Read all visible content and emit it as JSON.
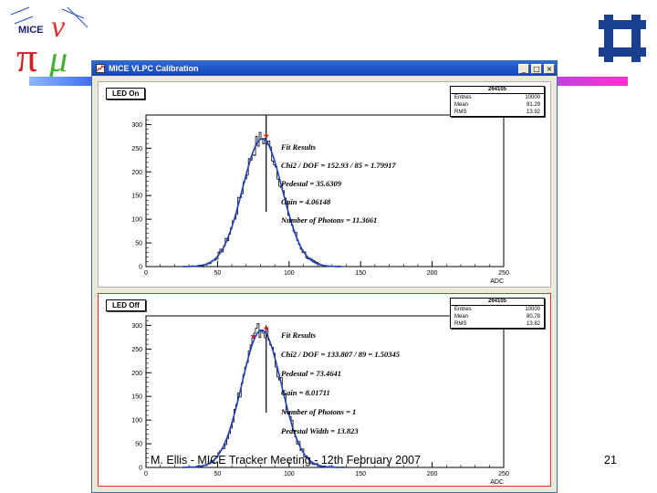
{
  "slide": {
    "footer": "M. Ellis - MICE Tracker Meeting - 12th February 2007",
    "page_number": "21",
    "logo_text": "MICE"
  },
  "window": {
    "title": "MICE VLPC Calibration",
    "controls": {
      "minimize": "_",
      "maximize": "□",
      "close": "×"
    }
  },
  "panels": [
    {
      "label": "LED On",
      "stats": {
        "name": "264105",
        "entries_label": "Entries",
        "entries": "10000",
        "mean_label": "Mean",
        "mean": "81.29",
        "rms_label": "RMS",
        "rms": "13.92"
      },
      "fit_results": [
        "Fit Results",
        "Chi2 / DOF = 152.93 / 85 = 1.79917",
        "Pedestal = 35.6309",
        "Gain = 4.06148",
        "Number of Photons = 11.3661"
      ],
      "xlabel": "ADC",
      "xticks": [
        "0",
        "50",
        "100",
        "150",
        "200",
        "250"
      ],
      "yticks": [
        "0",
        "50",
        "100",
        "150",
        "200",
        "250",
        "300"
      ]
    },
    {
      "label": "LED Off",
      "stats": {
        "name": "264105",
        "entries_label": "Entries",
        "entries": "10000",
        "mean_label": "Mean",
        "mean": "80.78",
        "rms_label": "RMS",
        "rms": "13.82"
      },
      "fit_results": [
        "Fit Results",
        "Chi2 / DOF = 133.807 / 89 = 1.50345",
        "Pedestal = 73.4641",
        "Gain = 8.01711",
        "Number of Photons = 1",
        "Pedestal Width = 13.823"
      ],
      "xlabel": "ADC",
      "xticks": [
        "0",
        "50",
        "100",
        "150",
        "200",
        "250"
      ],
      "yticks": [
        "0",
        "50",
        "100",
        "150",
        "200",
        "250",
        "300"
      ]
    }
  ],
  "chart_data": [
    {
      "type": "line",
      "xlabel": "ADC",
      "xlim": [
        0,
        250
      ],
      "ylim": [
        0,
        320
      ],
      "series": [
        {
          "mean": 81.29,
          "rms": 13.92,
          "peak": 270,
          "spike_x": 84,
          "spike_y": 330,
          "markers": [
            84
          ]
        }
      ]
    },
    {
      "type": "line",
      "xlabel": "ADC",
      "xlim": [
        0,
        250
      ],
      "ylim": [
        0,
        320
      ],
      "series": [
        {
          "mean": 80.78,
          "rms": 13.82,
          "peak": 290,
          "spike_x": 84,
          "spike_y": 300,
          "markers": [
            75,
            84
          ]
        }
      ]
    }
  ],
  "colors": {
    "fit_line": "#1f3fbf",
    "histogram": "#000000",
    "marker": "#e02020",
    "titlebar": "#2458c8"
  }
}
